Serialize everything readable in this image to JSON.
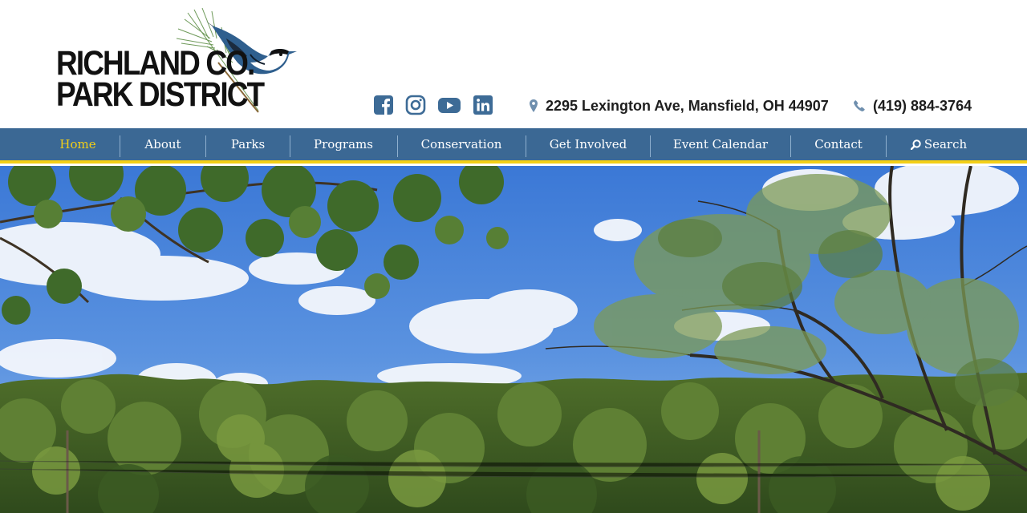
{
  "site": {
    "logo_line1": "RICHLAND CO.",
    "logo_line2": "PARK DISTRICT"
  },
  "social": [
    {
      "icon": "facebook-icon"
    },
    {
      "icon": "instagram-icon"
    },
    {
      "icon": "youtube-icon"
    },
    {
      "icon": "linkedin-icon"
    }
  ],
  "contact": {
    "address": "2295 Lexington Ave, Mansfield, OH 44907",
    "phone": "(419) 884-3764"
  },
  "nav": {
    "items": [
      {
        "label": "Home",
        "active": true
      },
      {
        "label": "About"
      },
      {
        "label": "Parks"
      },
      {
        "label": "Programs"
      },
      {
        "label": "Conservation"
      },
      {
        "label": "Get Involved"
      },
      {
        "label": "Event Calendar"
      },
      {
        "label": "Contact"
      },
      {
        "label": "Search",
        "icon": "search-icon"
      }
    ]
  },
  "colors": {
    "nav_bg": "#3b6894",
    "accent": "#f3cf17",
    "icon_blue": "#3d6b96",
    "text_dark": "#1e1e1e"
  }
}
